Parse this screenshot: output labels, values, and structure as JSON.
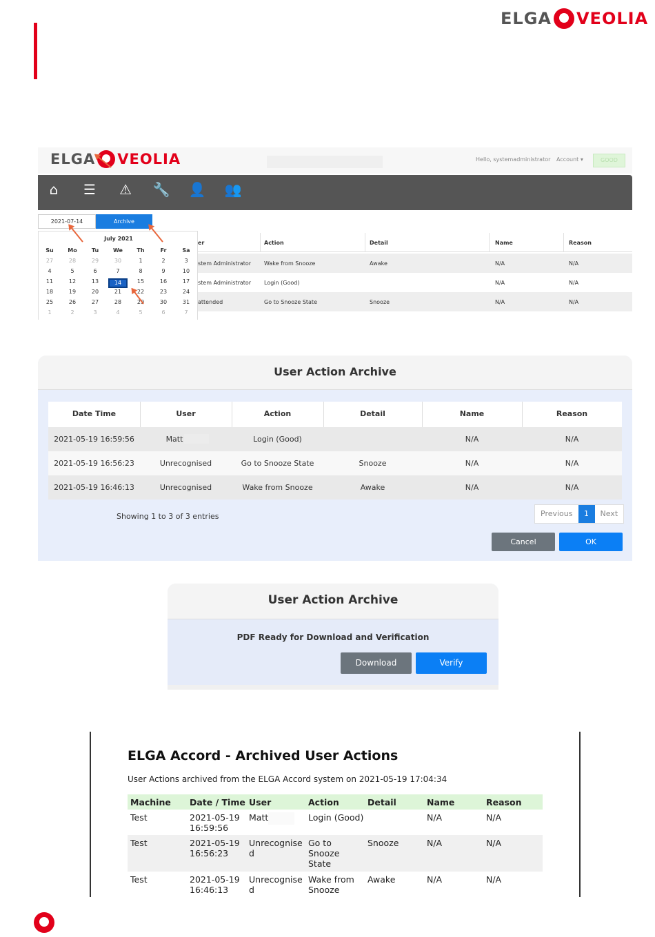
{
  "brand": {
    "word1": "ELGA",
    "word2": "VEOLIA"
  },
  "shot1": {
    "greeting": "Hello, systemadministrator",
    "account": "Account ▾",
    "status": "GOOD",
    "date_value": "2021-07-14",
    "archive_label": "Archive",
    "nav_icons": [
      "home-icon",
      "list-icon",
      "warning-icon",
      "wrench-icon",
      "user-lock-icon",
      "users-icon"
    ],
    "calendar": {
      "month": "July 2021",
      "weekdays": [
        "Su",
        "Mo",
        "Tu",
        "We",
        "Th",
        "Fr",
        "Sa"
      ],
      "weeks": [
        [
          "27",
          "28",
          "29",
          "30",
          "1",
          "2",
          "3"
        ],
        [
          "4",
          "5",
          "6",
          "7",
          "8",
          "9",
          "10"
        ],
        [
          "11",
          "12",
          "13",
          "14",
          "15",
          "16",
          "17"
        ],
        [
          "18",
          "19",
          "20",
          "21",
          "22",
          "23",
          "24"
        ],
        [
          "25",
          "26",
          "27",
          "28",
          "29",
          "30",
          "31"
        ],
        [
          "1",
          "2",
          "3",
          "4",
          "5",
          "6",
          "7"
        ]
      ],
      "selected": "14"
    },
    "table": {
      "headers": [
        "er",
        "Action",
        "Detail",
        "Name",
        "Reason"
      ],
      "rows": [
        [
          "stem Administrator",
          "Wake from Snooze",
          "Awake",
          "N/A",
          "N/A"
        ],
        [
          "stem Administrator",
          "Login (Good)",
          "",
          "N/A",
          "N/A"
        ],
        [
          "attended",
          "Go to Snooze State",
          "Snooze",
          "N/A",
          "N/A"
        ]
      ]
    }
  },
  "shot2": {
    "title": "User Action Archive",
    "headers": [
      "Date Time",
      "User",
      "Action",
      "Detail",
      "Name",
      "Reason"
    ],
    "rows": [
      [
        "2021-05-19 16:59:56",
        "Matt",
        "Login (Good)",
        "",
        "N/A",
        "N/A"
      ],
      [
        "2021-05-19 16:56:23",
        "Unrecognised",
        "Go to Snooze State",
        "Snooze",
        "N/A",
        "N/A"
      ],
      [
        "2021-05-19 16:46:13",
        "Unrecognised",
        "Wake from Snooze",
        "Awake",
        "N/A",
        "N/A"
      ]
    ],
    "showing": "Showing 1 to 3 of 3 entries",
    "previous": "Previous",
    "page": "1",
    "next": "Next",
    "cancel": "Cancel",
    "ok": "OK"
  },
  "shot3": {
    "title": "User Action Archive",
    "message": "PDF Ready for Download and Verification",
    "download": "Download",
    "verify": "Verify"
  },
  "pdf": {
    "title": "ELGA Accord - Archived User Actions",
    "subtitle": "User Actions archived from the ELGA Accord system on 2021-05-19 17:04:34",
    "headers": [
      "Machine",
      "Date / Time",
      "User",
      "Action",
      "Detail",
      "Name",
      "Reason"
    ],
    "rows": [
      [
        "Test",
        "2021-05-19\n16:59:56",
        "Matt",
        "Login (Good)",
        "",
        "N/A",
        "N/A"
      ],
      [
        "Test",
        "2021-05-19\n16:56:23",
        "Unrecognise\nd",
        "Go to\nSnooze\nState",
        "Snooze",
        "N/A",
        "N/A"
      ],
      [
        "Test",
        "2021-05-19\n16:46:13",
        "Unrecognise\nd",
        "Wake from\nSnooze",
        "Awake",
        "N/A",
        "N/A"
      ]
    ]
  },
  "colors": {
    "brand_red": "#e2001a",
    "primary_blue": "#0b7ff5",
    "secondary_gray": "#6c757d",
    "arrow": "#e8673d"
  }
}
